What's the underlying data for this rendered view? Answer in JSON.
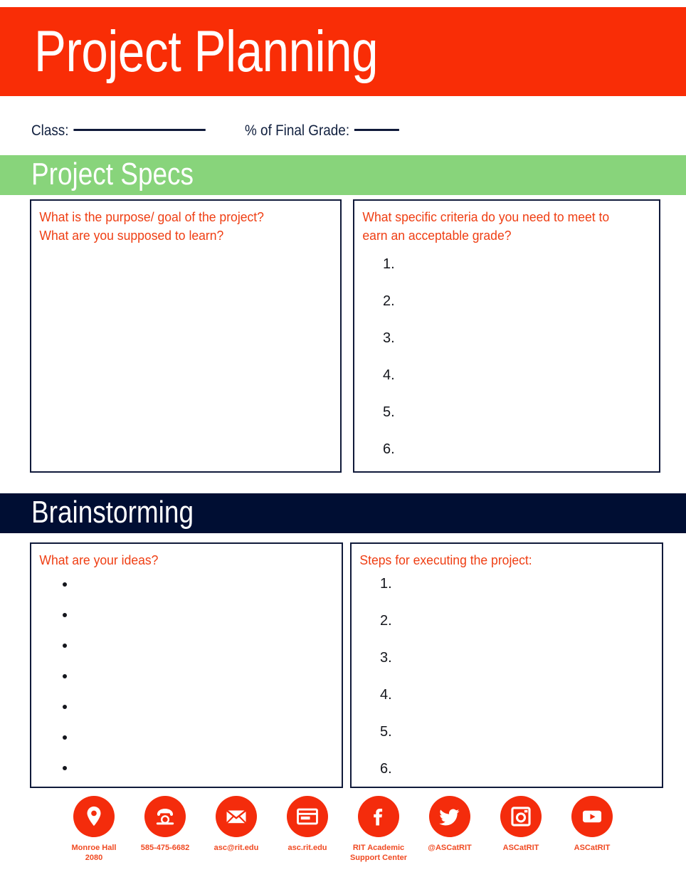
{
  "document": {
    "title": "Project Planning"
  },
  "meta": {
    "class_label": "Class:",
    "grade_label": "% of Final Grade:"
  },
  "sections": [
    {
      "heading": "Project Specs",
      "band_color": "#88D47B",
      "left_box": {
        "prompt": "What is the purpose/ goal of the project?\nWhat are you supposed to learn?",
        "items": []
      },
      "right_box": {
        "prompt": "What specific criteria do you need to meet to earn an acceptable grade?",
        "items": [
          "1.",
          "2.",
          "3.",
          "4.",
          "5.",
          "6."
        ]
      }
    },
    {
      "heading": "Brainstorming",
      "band_color": "#000E33",
      "left_box": {
        "prompt": "What are your ideas?",
        "items": [
          "",
          "",
          "",
          "",
          "",
          "",
          ""
        ]
      },
      "right_box": {
        "prompt": "Steps for executing the project:",
        "items": [
          "1.",
          "2.",
          "3.",
          "4.",
          "5.",
          "6."
        ]
      }
    }
  ],
  "footer": {
    "contacts": [
      {
        "icon": "map-pin-icon",
        "caption": "Monroe Hall\n2080"
      },
      {
        "icon": "phone-icon",
        "caption": "585-475-6682"
      },
      {
        "icon": "envelope-icon",
        "caption": "asc@rit.edu"
      },
      {
        "icon": "website-icon",
        "caption": "asc.rit.edu"
      },
      {
        "icon": "facebook-icon",
        "caption": "RIT Academic\nSupport Center"
      },
      {
        "icon": "twitter-icon",
        "caption": "@ASCatRIT"
      },
      {
        "icon": "instagram-icon",
        "caption": "ASCatRIT"
      },
      {
        "icon": "youtube-icon",
        "caption": "ASCatRIT"
      }
    ]
  },
  "colors": {
    "header_orange": "#F92D06",
    "accent_orange": "#EF3E13",
    "section_green": "#88D47B",
    "section_navy": "#000E33",
    "border_navy": "#101A3A"
  }
}
